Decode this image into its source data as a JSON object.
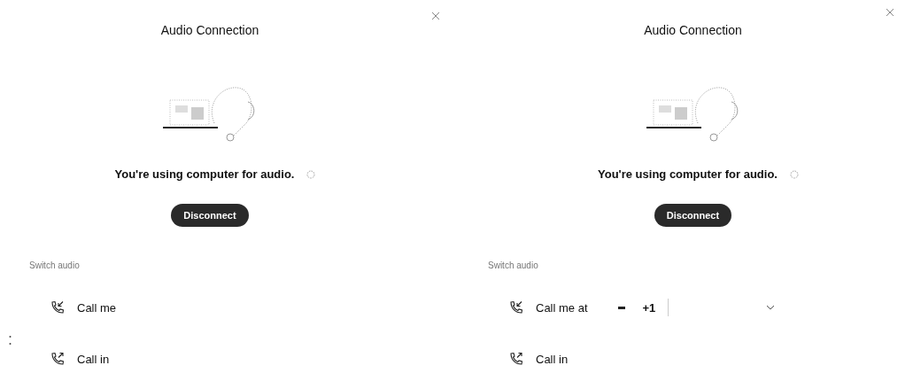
{
  "panels": [
    {
      "title": "Audio Connection",
      "status": "You're using computer for audio.",
      "button": "Disconnect",
      "section_label": "Switch audio",
      "options": [
        {
          "kind": "simple",
          "label": "Call me"
        },
        {
          "kind": "simple",
          "label": "Call in"
        }
      ]
    },
    {
      "title": "Audio Connection",
      "status": "You're using computer for audio.",
      "button": "Disconnect",
      "section_label": "Switch audio",
      "options": [
        {
          "kind": "phone",
          "label": "Call me at",
          "country_code": "+1"
        },
        {
          "kind": "simple",
          "label": "Call in"
        }
      ]
    }
  ]
}
